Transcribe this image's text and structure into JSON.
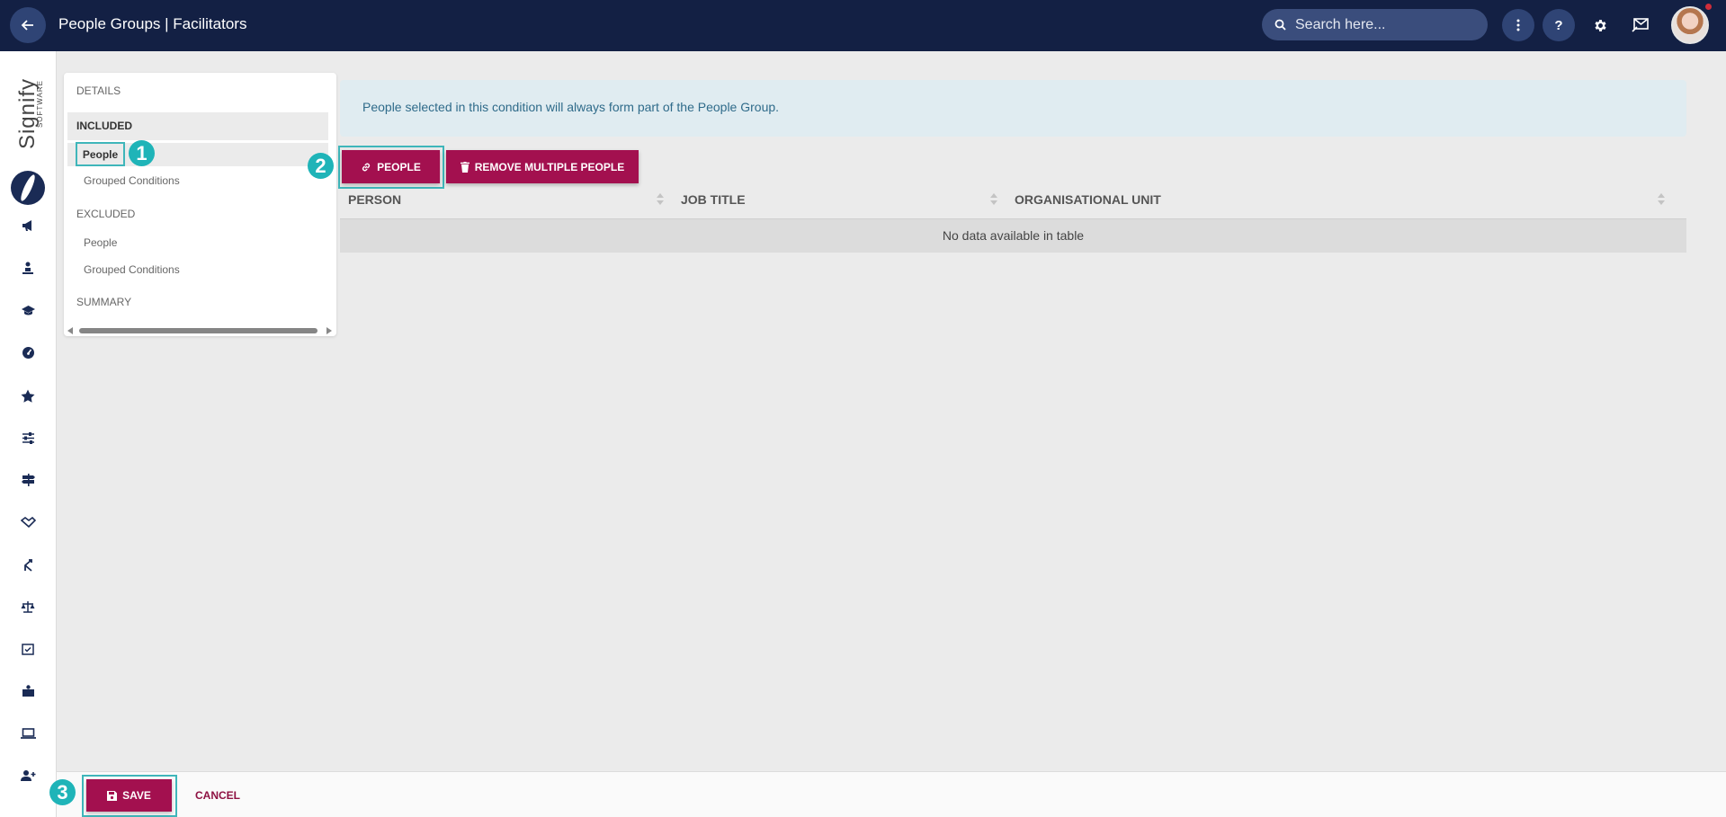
{
  "header": {
    "title": "People Groups | Facilitators",
    "search_placeholder": "Search here...",
    "icons": [
      "back-arrow-icon",
      "search-icon",
      "more-vertical-icon",
      "help-icon",
      "gear-icon",
      "messages-icon"
    ]
  },
  "sidebar": {
    "logo_text": "Signify",
    "logo_sub": "SOFTWARE",
    "icons": [
      "megaphone-icon",
      "person-podium-icon",
      "graduation-cap-icon",
      "gauge-icon",
      "star-icon",
      "sliders-icon",
      "signpost-icon",
      "handshake-icon",
      "route-icon",
      "scales-icon",
      "calendar-check-icon",
      "briefcase-user-icon",
      "laptop-icon",
      "user-plus-icon"
    ]
  },
  "nav": {
    "details": "DETAILS",
    "included": "INCLUDED",
    "included_people": "People",
    "included_grouped": "Grouped Conditions",
    "excluded": "EXCLUDED",
    "excluded_people": "People",
    "excluded_grouped": "Grouped Conditions",
    "summary": "SUMMARY"
  },
  "info_text": "People selected in this condition will always form part of the People Group.",
  "actions": {
    "link_people": "PEOPLE",
    "remove_multiple": "REMOVE MULTIPLE PEOPLE"
  },
  "table": {
    "columns": [
      "PERSON",
      "JOB TITLE",
      "ORGANISATIONAL UNIT"
    ],
    "empty_text": "No data available in table"
  },
  "footer": {
    "save": "SAVE",
    "cancel": "CANCEL"
  },
  "steps": [
    "1",
    "2",
    "3"
  ],
  "colors": {
    "topbar": "#132044",
    "primary_button": "#a3104f",
    "highlight": "#3fb6ba",
    "step_badge": "#1fb4b8"
  }
}
